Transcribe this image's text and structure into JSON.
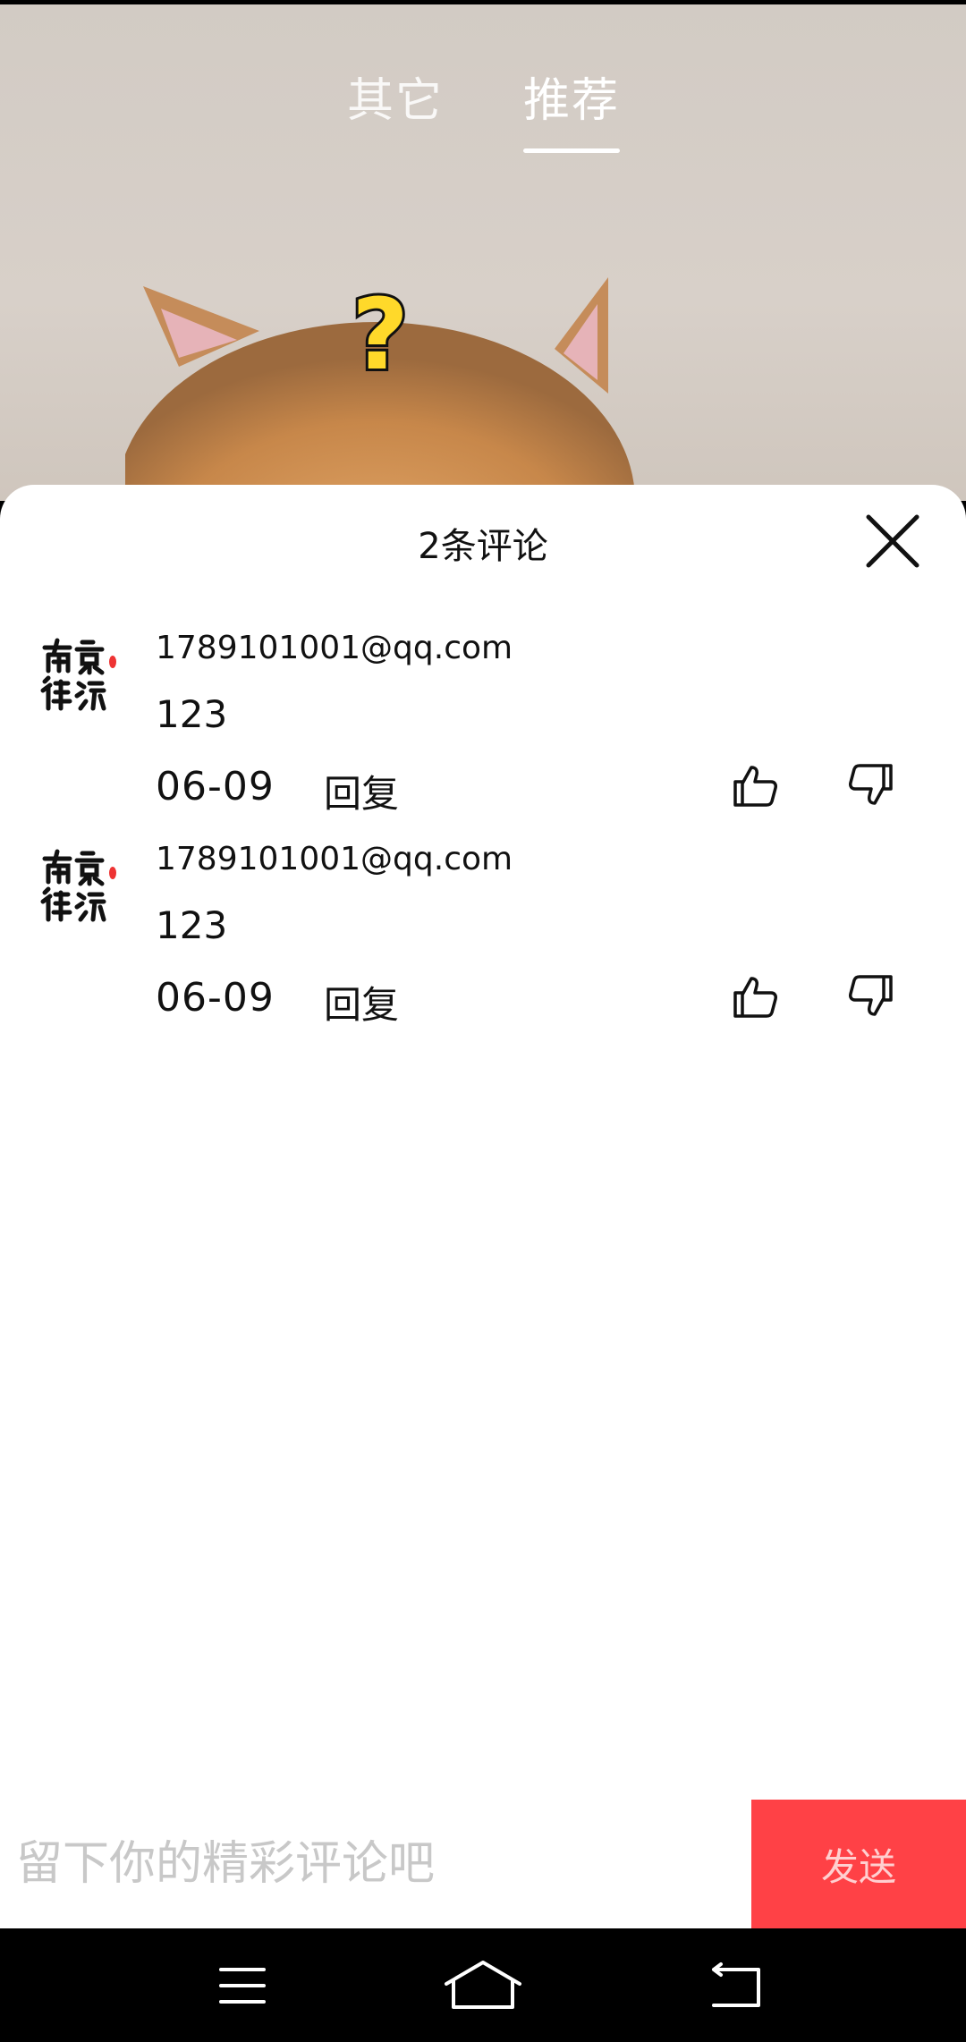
{
  "video": {
    "tabs": [
      {
        "label": "其它",
        "active": false
      },
      {
        "label": "推荐",
        "active": true
      }
    ]
  },
  "comments_panel": {
    "title": "2条评论",
    "comments": [
      {
        "user": "1789101001@qq.com",
        "text": "123",
        "date": "06-09",
        "reply_label": "回复"
      },
      {
        "user": "1789101001@qq.com",
        "text": "123",
        "date": "06-09",
        "reply_label": "回复"
      }
    ]
  },
  "input": {
    "placeholder": "留下你的精彩评论吧",
    "value": "",
    "send_label": "发送"
  },
  "colors": {
    "accent": "#ff4146",
    "sheet_bg": "#ffffff",
    "nav_bg": "#000000"
  },
  "icons": {
    "close": "close-icon",
    "like": "thumbs-up-icon",
    "dislike": "thumbs-down-icon",
    "nav_menu": "menu-icon",
    "nav_home": "home-icon",
    "nav_back": "back-icon"
  }
}
